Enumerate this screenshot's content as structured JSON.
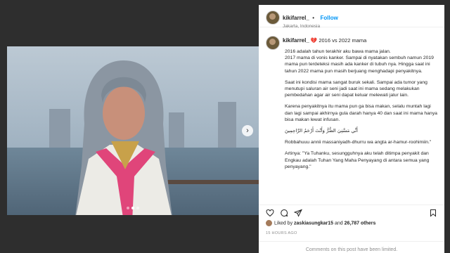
{
  "post": {
    "username": "kikifarrel_",
    "follow_label": "Follow",
    "location": "Jakarta, Indonesia",
    "caption_title": "💔 2016 vs 2022 mama",
    "caption": [
      "2016 adalah tahun terakhir aku bawa mama jalan.\n2017 mama di vonis kanker. Sampai di nyatakan sembuh namun 2019 mama pun terdeteksi masih ada kanker di tubuh nya. Hingga saat ini tahun 2022 mama pun masih berjuang menghadapi penyakitnya.",
      "Saat ini kondisi mama sangat buruk sekali. Sampai ada tumor yang menutupi saluran air seni jadi saat ini mama sedang melakukan pembedahan agar air seni dapat keluar melewati jalur lain.",
      "Karena penyakitnya itu mama pun ga bisa makan, selalu muntah lagi dan lagi sampai akhirnya gula darah hanya 40 dan saat ini mama hanya bisa makan lewat infusan.",
      "أَنِّي مَسَّنِيَ الضُّرُّ وَأَنْتَ أَرْحَمُ الرَّاحِمِينَ",
      "Robbahuuu annii massaniyadh-dhurru wa angta ar-hamur-roohimiin.\"",
      "Artinya: \"Ya Tuhanku, sesungguhnya aku telah ditimpa penyakit dan Engkau adalah Tuhan Yang Maha Penyayang di antara semua yang penyayang.\""
    ],
    "liked_by_prefix": "Liked by ",
    "liked_by_user": "zaskiasungkar15",
    "liked_and": " and ",
    "likes_count": "26,787 others",
    "time": "15 HOURS AGO",
    "comments_status": "Comments on this post have been limited."
  },
  "icons": {
    "heart": "heart-icon",
    "comment": "comment-icon",
    "share": "share-icon",
    "save": "bookmark-icon",
    "next": "chevron-right-icon"
  },
  "colors": {
    "accent": "#0095f6",
    "text": "#262626",
    "muted": "#8e8e8e"
  },
  "carousel": {
    "slide": 2,
    "total": 3
  }
}
